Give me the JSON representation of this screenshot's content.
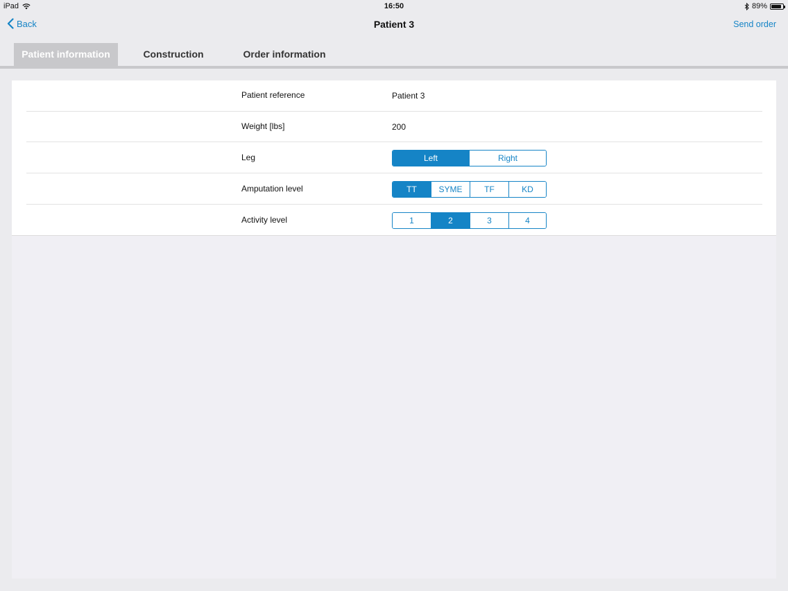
{
  "status_bar": {
    "device": "iPad",
    "time": "16:50",
    "battery_percent": "89%",
    "battery_level": 0.89,
    "icons": [
      "wifi-icon",
      "bluetooth-icon",
      "battery-icon"
    ]
  },
  "nav": {
    "back_label": "Back",
    "title": "Patient 3",
    "send_label": "Send order"
  },
  "tabs": [
    {
      "label": "Patient information",
      "active": true
    },
    {
      "label": "Construction",
      "active": false
    },
    {
      "label": "Order information",
      "active": false
    }
  ],
  "form": {
    "patient_reference": {
      "label": "Patient reference",
      "value": "Patient 3"
    },
    "weight": {
      "label": "Weight [lbs]",
      "value": "200"
    },
    "leg": {
      "label": "Leg",
      "options": [
        "Left",
        "Right"
      ],
      "selected": "Left"
    },
    "amputation_level": {
      "label": "Amputation level",
      "options": [
        "TT",
        "SYME",
        "TF",
        "KD"
      ],
      "selected": "TT"
    },
    "activity_level": {
      "label": "Activity level",
      "options": [
        "1",
        "2",
        "3",
        "4"
      ],
      "selected": "2"
    }
  },
  "colors": {
    "accent": "#1584c6",
    "tab_active_bg": "#c8c8cb",
    "background": "#ebebee"
  }
}
